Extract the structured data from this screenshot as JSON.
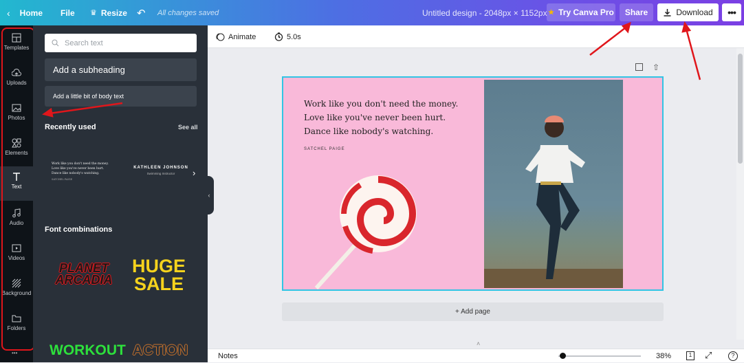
{
  "topbar": {
    "home": "Home",
    "file": "File",
    "resize": "Resize",
    "save_status": "All changes saved",
    "design_title": "Untitled design - 2048px × 1152px",
    "try_pro": "Try Canva Pro",
    "share": "Share",
    "download": "Download"
  },
  "rail": {
    "items": [
      {
        "label": "Templates",
        "icon": "templates-icon"
      },
      {
        "label": "Uploads",
        "icon": "upload-cloud-icon"
      },
      {
        "label": "Photos",
        "icon": "photo-icon"
      },
      {
        "label": "Elements",
        "icon": "shapes-icon"
      },
      {
        "label": "Text",
        "icon": "text-t-icon"
      },
      {
        "label": "Audio",
        "icon": "music-note-icon"
      },
      {
        "label": "Videos",
        "icon": "video-icon"
      },
      {
        "label": "Background",
        "icon": "background-pattern-icon"
      },
      {
        "label": "Folders",
        "icon": "folder-icon"
      }
    ]
  },
  "panel": {
    "search_placeholder": "Search text",
    "subheading": "Add a subheading",
    "body_text": "Add a little bit of body text",
    "recently_used": "Recently used",
    "see_all": "See all",
    "recent_quote": [
      "Work like you don't need the money.",
      "Love like you've never been hurt.",
      "Dance like nobody's watching."
    ],
    "recent_author": "SATCHEL PAIGE",
    "recent_name": "KATHLEEN JOHNSON",
    "recent_name_sub": "Swimming Instructor",
    "font_combinations": "Font combinations",
    "combos": [
      "PLANET ARCADIA",
      "HUGE SALE",
      "WORKOUT",
      "ACTION"
    ]
  },
  "canvas": {
    "animate": "Animate",
    "duration": "5.0s",
    "quote_lines": [
      "Work like you don't need the money.",
      "Love like you've never been hurt.",
      "Dance like nobody's watching."
    ],
    "author": "SATCHEL PAIGE",
    "add_page": "+ Add page"
  },
  "bottom": {
    "notes": "Notes",
    "zoom": "38%"
  },
  "colors": {
    "design_bg": "#f9b9d9",
    "selection": "#31c4e4",
    "annotation_red": "#e0161b"
  }
}
